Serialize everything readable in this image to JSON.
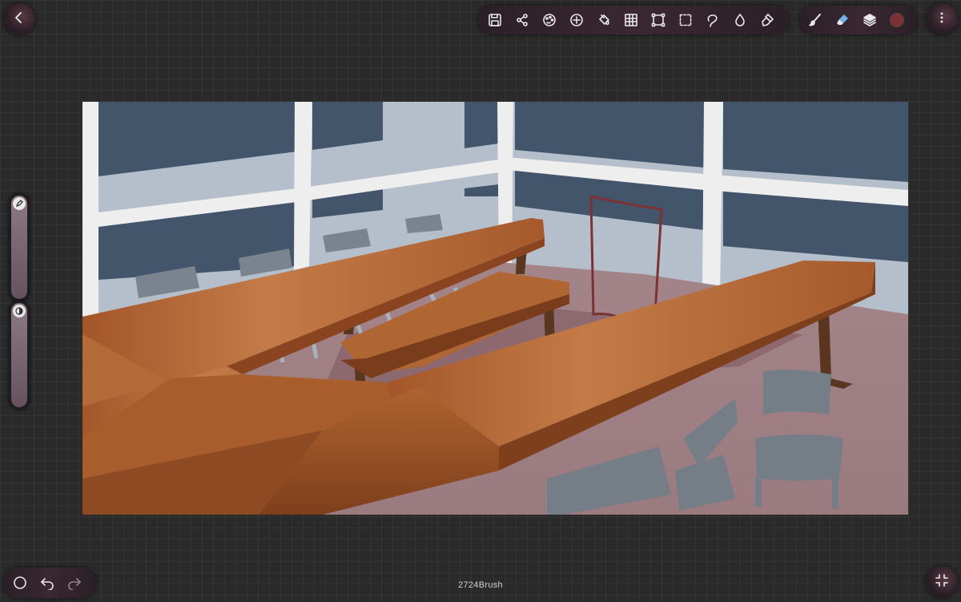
{
  "app": {
    "brush_name": "2724Brush"
  },
  "top_bar": {
    "back_icon": "chevron-left-icon",
    "tools": [
      {
        "name": "save",
        "icon": "save-icon"
      },
      {
        "name": "share",
        "icon": "share-icon"
      },
      {
        "name": "adjust",
        "icon": "palette-adjust-icon"
      },
      {
        "name": "add",
        "icon": "plus-circle-icon"
      },
      {
        "name": "fill",
        "icon": "paint-bucket-icon"
      },
      {
        "name": "grid",
        "icon": "grid-icon"
      },
      {
        "name": "transform",
        "icon": "transform-icon"
      },
      {
        "name": "selection",
        "icon": "dashed-selection-icon"
      },
      {
        "name": "lasso",
        "icon": "lasso-icon"
      },
      {
        "name": "blur",
        "icon": "droplet-icon"
      },
      {
        "name": "smudge",
        "icon": "smudge-icon"
      }
    ],
    "brush_tools": [
      {
        "name": "brush",
        "icon": "brush-icon"
      },
      {
        "name": "eraser",
        "icon": "eraser-icon"
      },
      {
        "name": "layers",
        "icon": "layers-icon"
      },
      {
        "name": "color",
        "icon": "color-swatch"
      }
    ],
    "current_color": "#7a3234",
    "menu_icon": "more-vertical-icon"
  },
  "left_sliders": {
    "size_icon": "pencil-icon",
    "opacity_icon": "opacity-icon"
  },
  "bottom_bar": {
    "shape_icon": "circle-icon",
    "undo_icon": "undo-icon",
    "redo_icon": "redo-icon",
    "fullscreen_icon": "collapse-icon"
  },
  "palette": {
    "window_glass": "#43556b",
    "frame_white": "#eeeeee",
    "wall_blue_grey": "#aeb8c5",
    "floor": "#9c7f83",
    "table_wood": "#a0532a",
    "chair_grey": "#757d87",
    "accent": "#7a3234"
  }
}
